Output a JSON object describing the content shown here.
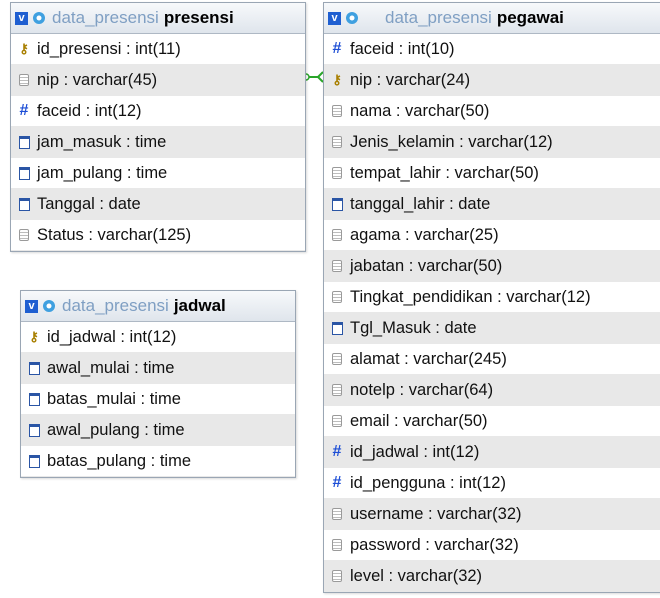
{
  "tables": {
    "presensi": {
      "db": "data_presensi",
      "name": "presensi",
      "columns": [
        {
          "icon": "primary-key-icon",
          "text": "id_presensi : int(11)"
        },
        {
          "icon": "string-icon",
          "text": "nip : varchar(45)"
        },
        {
          "icon": "numeric-icon",
          "text": "faceid : int(12)"
        },
        {
          "icon": "time-icon",
          "text": "jam_masuk : time"
        },
        {
          "icon": "time-icon",
          "text": "jam_pulang : time"
        },
        {
          "icon": "date-icon",
          "text": "Tanggal : date"
        },
        {
          "icon": "string-icon",
          "text": "Status : varchar(125)"
        }
      ]
    },
    "jadwal": {
      "db": "data_presensi",
      "name": "jadwal",
      "columns": [
        {
          "icon": "primary-key-icon",
          "text": "id_jadwal : int(12)"
        },
        {
          "icon": "time-icon",
          "text": "awal_mulai : time"
        },
        {
          "icon": "time-icon",
          "text": "batas_mulai : time"
        },
        {
          "icon": "time-icon",
          "text": "awal_pulang : time"
        },
        {
          "icon": "time-icon",
          "text": "batas_pulang : time"
        }
      ]
    },
    "pegawai": {
      "db": "data_presensi",
      "name": "pegawai",
      "columns": [
        {
          "icon": "numeric-icon",
          "text": "faceid : int(10)"
        },
        {
          "icon": "primary-key-icon",
          "text": "nip : varchar(24)"
        },
        {
          "icon": "string-icon",
          "text": "nama : varchar(50)"
        },
        {
          "icon": "string-icon",
          "text": "Jenis_kelamin : varchar(12)"
        },
        {
          "icon": "string-icon",
          "text": "tempat_lahir : varchar(50)"
        },
        {
          "icon": "date-icon",
          "text": "tanggal_lahir : date"
        },
        {
          "icon": "string-icon",
          "text": "agama : varchar(25)"
        },
        {
          "icon": "string-icon",
          "text": "jabatan : varchar(50)"
        },
        {
          "icon": "string-icon",
          "text": "Tingkat_pendidikan : varchar(12)"
        },
        {
          "icon": "date-icon",
          "text": "Tgl_Masuk : date"
        },
        {
          "icon": "string-icon",
          "text": "alamat : varchar(245)"
        },
        {
          "icon": "string-icon",
          "text": "notelp : varchar(64)"
        },
        {
          "icon": "string-icon",
          "text": "email : varchar(50)"
        },
        {
          "icon": "numeric-icon",
          "text": "id_jadwal : int(12)"
        },
        {
          "icon": "numeric-icon",
          "text": "id_pengguna : int(12)"
        },
        {
          "icon": "string-icon",
          "text": "username : varchar(32)"
        },
        {
          "icon": "string-icon",
          "text": "password : varchar(32)"
        },
        {
          "icon": "string-icon",
          "text": "level : varchar(32)"
        }
      ]
    }
  },
  "toggle_label": "v",
  "colors": {
    "toggle": "#1f5fd1",
    "relation_line": "#2aa52a",
    "db_name": "#7f9fc3"
  }
}
